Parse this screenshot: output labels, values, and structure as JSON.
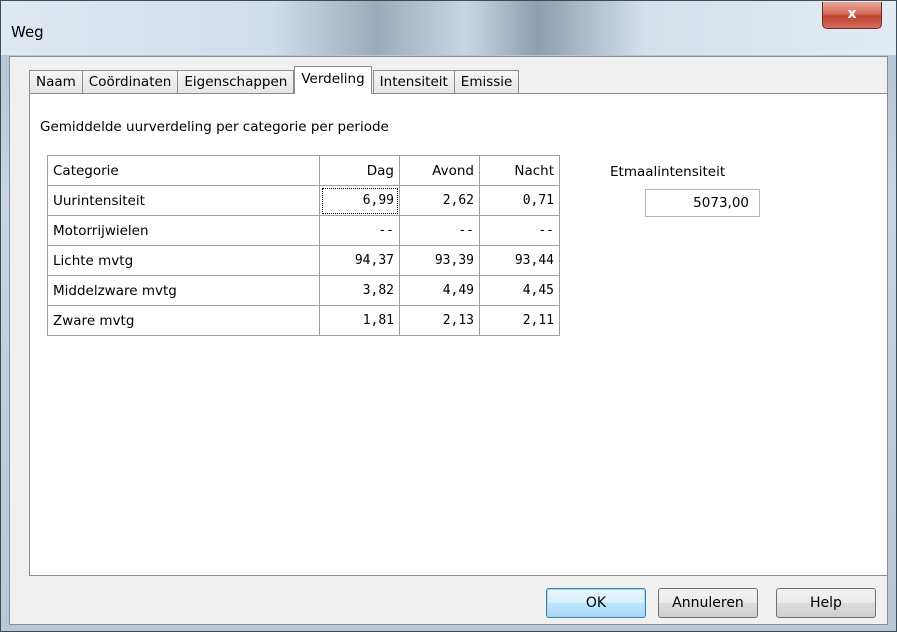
{
  "window": {
    "title": "Weg",
    "close_label": "x"
  },
  "tabs": [
    {
      "label": "Naam",
      "active": false
    },
    {
      "label": "Coördinaten",
      "active": false
    },
    {
      "label": "Eigenschappen",
      "active": false
    },
    {
      "label": "Verdeling",
      "active": true
    },
    {
      "label": "Intensiteit",
      "active": false
    },
    {
      "label": "Emissie",
      "active": false
    }
  ],
  "panel": {
    "subtitle": "Gemiddelde uurverdeling per categorie per periode",
    "table": {
      "headers": [
        "Categorie",
        "Dag",
        "Avond",
        "Nacht"
      ],
      "rows": [
        {
          "categorie": "Uurintensiteit",
          "dag": "6,99",
          "avond": "2,62",
          "nacht": "0,71"
        },
        {
          "categorie": "Motorrijwielen",
          "dag": "--",
          "avond": "--",
          "nacht": "--"
        },
        {
          "categorie": "Lichte mvtg",
          "dag": "94,37",
          "avond": "93,39",
          "nacht": "93,44"
        },
        {
          "categorie": "Middelzware mvtg",
          "dag": "3,82",
          "avond": "4,49",
          "nacht": "4,45"
        },
        {
          "categorie": "Zware mvtg",
          "dag": "1,81",
          "avond": "2,13",
          "nacht": "2,11"
        }
      ]
    },
    "etmaal": {
      "label": "Etmaalintensiteit",
      "value": "5073,00"
    }
  },
  "buttons": {
    "ok": "OK",
    "cancel": "Annuleren",
    "help": "Help"
  }
}
